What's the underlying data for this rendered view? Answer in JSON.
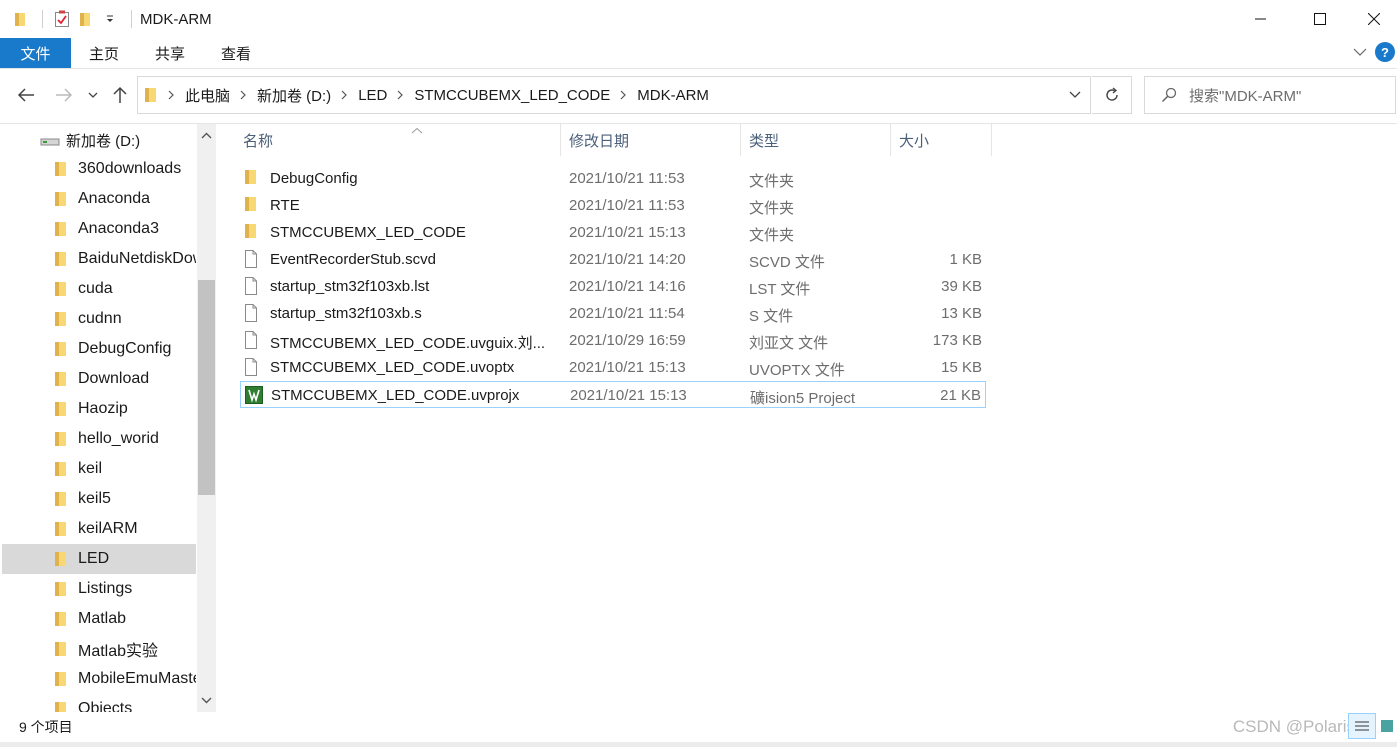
{
  "window": {
    "title": "MDK-ARM",
    "controls": [
      "minimize",
      "maximize",
      "close"
    ]
  },
  "ribbon": {
    "tabs": [
      {
        "label": "文件",
        "active": true
      },
      {
        "label": "主页"
      },
      {
        "label": "共享"
      },
      {
        "label": "查看"
      }
    ]
  },
  "address": {
    "breadcrumbs": [
      "此电脑",
      "新加卷 (D:)",
      "LED",
      "STMCCUBEMX_LED_CODE",
      "MDK-ARM"
    ]
  },
  "search": {
    "placeholder": "搜索\"MDK-ARM\""
  },
  "nav": {
    "root_label": "新加卷 (D:)",
    "items": [
      {
        "label": "360downloads"
      },
      {
        "label": "Anaconda"
      },
      {
        "label": "Anaconda3"
      },
      {
        "label": "BaiduNetdiskDownload"
      },
      {
        "label": "cuda"
      },
      {
        "label": "cudnn"
      },
      {
        "label": "DebugConfig"
      },
      {
        "label": "Download"
      },
      {
        "label": "Haozip"
      },
      {
        "label": "hello_worid"
      },
      {
        "label": "keil"
      },
      {
        "label": "keil5"
      },
      {
        "label": "keilARM"
      },
      {
        "label": "LED",
        "selected": true
      },
      {
        "label": "Listings"
      },
      {
        "label": "Matlab"
      },
      {
        "label": "Matlab实验"
      },
      {
        "label": "MobileEmuMaster"
      },
      {
        "label": "Objects"
      }
    ]
  },
  "columns": {
    "name": "名称",
    "date": "修改日期",
    "type": "类型",
    "size": "大小"
  },
  "files": [
    {
      "icon": "folder-icon",
      "name": "DebugConfig",
      "date": "2021/10/21 11:53",
      "type": "文件夹",
      "size": ""
    },
    {
      "icon": "folder-icon",
      "name": "RTE",
      "date": "2021/10/21 11:53",
      "type": "文件夹",
      "size": ""
    },
    {
      "icon": "folder-icon",
      "name": "STMCCUBEMX_LED_CODE",
      "date": "2021/10/21 15:13",
      "type": "文件夹",
      "size": ""
    },
    {
      "icon": "file-icon",
      "name": "EventRecorderStub.scvd",
      "date": "2021/10/21 14:20",
      "type": "SCVD 文件",
      "size": "1 KB"
    },
    {
      "icon": "file-icon",
      "name": "startup_stm32f103xb.lst",
      "date": "2021/10/21 14:16",
      "type": "LST 文件",
      "size": "39 KB"
    },
    {
      "icon": "file-icon",
      "name": "startup_stm32f103xb.s",
      "date": "2021/10/21 11:54",
      "type": "S 文件",
      "size": "13 KB"
    },
    {
      "icon": "file-icon",
      "name": "STMCCUBEMX_LED_CODE.uvguix.刘...",
      "date": "2021/10/29 16:59",
      "type": "刘亚文 文件",
      "size": "173 KB"
    },
    {
      "icon": "file-icon",
      "name": "STMCCUBEMX_LED_CODE.uvoptx",
      "date": "2021/10/21 15:13",
      "type": "UVOPTX 文件",
      "size": "15 KB"
    },
    {
      "icon": "keil-project-icon",
      "name": "STMCCUBEMX_LED_CODE.uvprojx",
      "date": "2021/10/21 15:13",
      "type": "礦ision5 Project",
      "size": "21 KB",
      "selected": true
    }
  ],
  "status": {
    "item_count": "9 个项目"
  },
  "watermark": "CSDN @Polaris",
  "colors": {
    "accent": "#1979ca",
    "selection_border": "#99d1ff",
    "nav_selected": "#d9d9d9",
    "folder": "#f8d775"
  }
}
